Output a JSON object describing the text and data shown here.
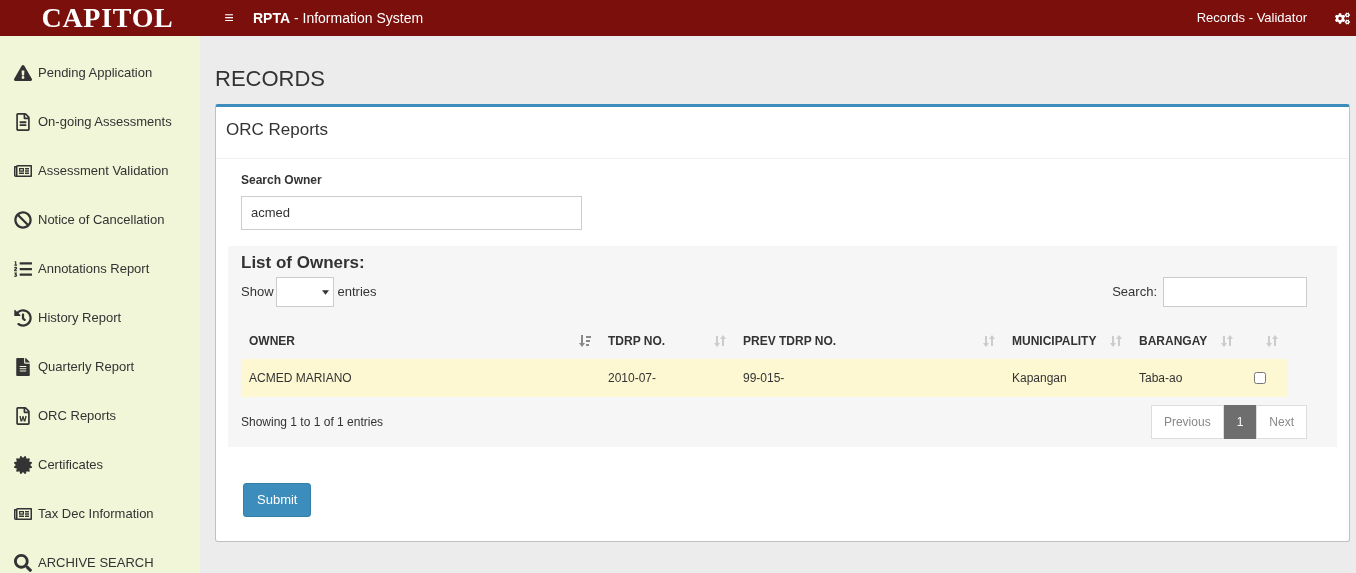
{
  "header": {
    "logo": "CAPITOL",
    "menu_icon": "≡",
    "app_title_bold": "RPTA",
    "app_title_rest": " - Information System",
    "user_role": "Records - Validator"
  },
  "sidebar": {
    "items": [
      {
        "kind": "warning",
        "label": "Pending Application"
      },
      {
        "kind": "file",
        "label": "On-going Assessments"
      },
      {
        "kind": "newspaper",
        "label": "Assessment Validation"
      },
      {
        "kind": "ban",
        "label": "Notice of Cancellation"
      },
      {
        "kind": "ordered-list",
        "label": "Annotations Report"
      },
      {
        "kind": "history",
        "label": "History Report"
      },
      {
        "kind": "file-text",
        "label": "Quarterly Report"
      },
      {
        "kind": "word",
        "label": "ORC Reports"
      },
      {
        "kind": "certificate",
        "label": "Certificates"
      },
      {
        "kind": "newspaper",
        "label": "Tax Dec Information"
      },
      {
        "kind": "search",
        "label": "ARCHIVE SEARCH"
      }
    ]
  },
  "page_title": "RECORDS",
  "panel": {
    "title": "ORC Reports",
    "search_owner": {
      "label": "Search Owner",
      "value": "acmed"
    },
    "list": {
      "title": "List of Owners:",
      "show_label": "Show",
      "entries_label": "entries",
      "search_label": "Search:",
      "columns": [
        {
          "label": "OWNER",
          "sorted": true
        },
        {
          "label": "TDRP NO.",
          "sorted": false
        },
        {
          "label": "PREV TDRP NO.",
          "sorted": false
        },
        {
          "label": "MUNICIPALITY",
          "sorted": false
        },
        {
          "label": "BARANGAY",
          "sorted": false
        },
        {
          "sorted": false
        }
      ],
      "rows": [
        {
          "owner": "ACMED MARIANO",
          "tdrp": "2010-07-",
          "prev_tdrp": "99-015-",
          "municipality": "Kapangan",
          "barangay": "Taba-ao",
          "checked": false,
          "selected": true
        }
      ],
      "info": "Showing 1 to 1 of 1 entries",
      "pagination": [
        {
          "label": "Previous",
          "disabled": true,
          "selected": false
        },
        {
          "label": "1",
          "disabled": false,
          "selected": true
        },
        {
          "label": "Next",
          "disabled": true,
          "selected": false
        }
      ]
    },
    "submit": "Submit"
  }
}
